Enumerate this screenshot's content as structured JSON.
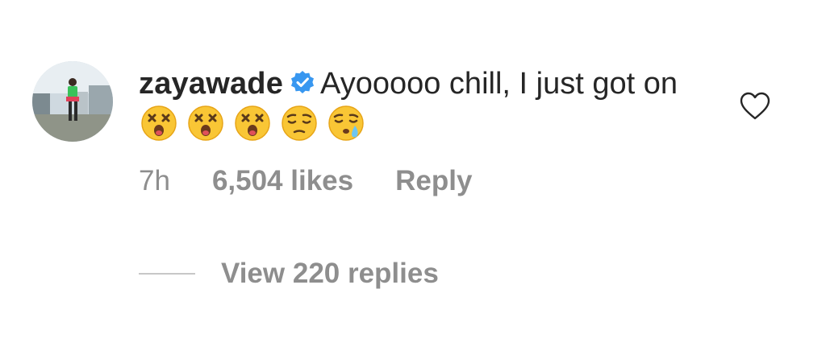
{
  "comment": {
    "username": "zayawade",
    "verified_icon": "verified-badge-icon",
    "text": "Ayooooo chill, I just got on",
    "emojis": [
      "dizzy-face-emoji",
      "dizzy-face-emoji",
      "dizzy-face-emoji",
      "pensive-face-emoji",
      "sleepy-face-emoji"
    ],
    "time_ago": "7h",
    "likes": "6,504 likes",
    "reply_label": "Reply",
    "like_icon": "heart-icon"
  },
  "replies": {
    "label": "View 220 replies"
  },
  "colors": {
    "text": "#262626",
    "secondary": "#8e8e8e",
    "verified": "#3897f0",
    "divider": "#c7c7c7"
  }
}
